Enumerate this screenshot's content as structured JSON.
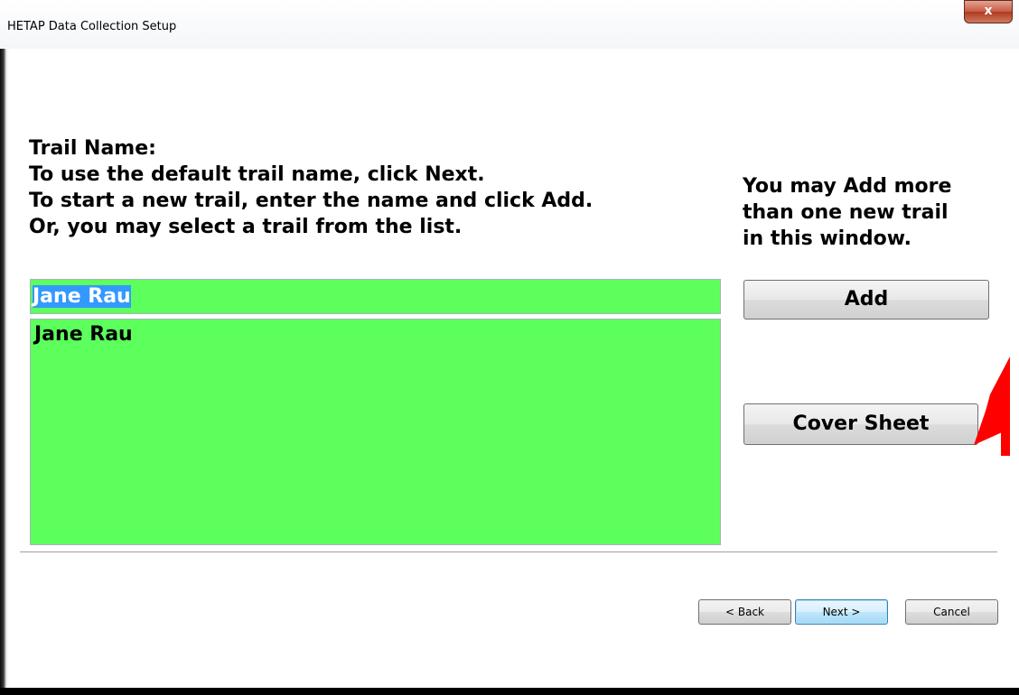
{
  "window": {
    "title": "HETAP Data Collection Setup",
    "close_label": "x"
  },
  "instructions": {
    "line1": "Trail Name:",
    "line2": "To use the default trail name, click Next.",
    "line3": "To start a new trail, enter the name and click Add.",
    "line4": "Or, you may select a trail from the list."
  },
  "side_note": {
    "line1": "You may Add more",
    "line2": "than one new trail",
    "line3": "in this window."
  },
  "name_input": {
    "value": "Jane Rau"
  },
  "trail_list": {
    "items": [
      "Jane Rau"
    ]
  },
  "buttons": {
    "add": "Add",
    "cover_sheet": "Cover Sheet",
    "back": "< Back",
    "next": "Next >",
    "cancel": "Cancel"
  },
  "colors": {
    "field_background": "#5cff5c",
    "selection": "#3399ff",
    "arrow": "#ff0000"
  },
  "annotation": {
    "arrow_icon": "red-arrow-icon"
  }
}
